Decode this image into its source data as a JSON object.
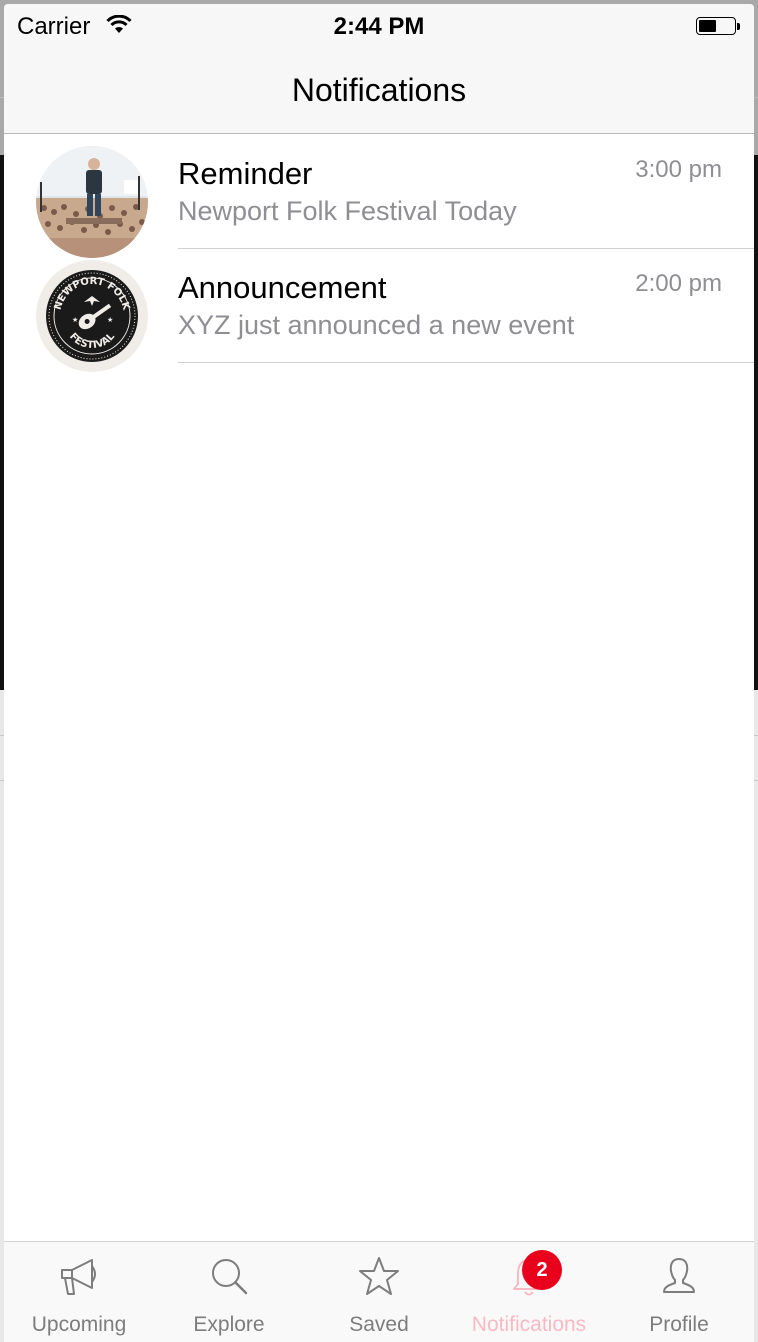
{
  "status_bar": {
    "carrier": "Carrier",
    "time": "2:44 PM",
    "wifi_icon": "wifi-icon",
    "battery_icon": "battery-icon",
    "battery_level": 0.5
  },
  "nav": {
    "title": "Notifications"
  },
  "notifications": [
    {
      "title": "Reminder",
      "subtitle": "Newport Folk Festival Today",
      "time": "3:00 pm",
      "avatar": "concert-photo-avatar"
    },
    {
      "title": "Announcement",
      "subtitle": "XYZ just announced a new event",
      "time": "2:00 pm",
      "avatar": "newport-folk-festival-logo"
    }
  ],
  "logo_text": {
    "top": "NEWPORT FOLK",
    "bottom": "FESTIVAL"
  },
  "tabs": [
    {
      "label": "Upcoming",
      "icon": "megaphone-icon",
      "active": false
    },
    {
      "label": "Explore",
      "icon": "search-icon",
      "active": false
    },
    {
      "label": "Saved",
      "icon": "star-icon",
      "active": false
    },
    {
      "label": "Notifications",
      "icon": "bell-icon",
      "active": true,
      "badge": "2"
    },
    {
      "label": "Profile",
      "icon": "profile-icon",
      "active": false
    }
  ],
  "colors": {
    "active_tab": "#f9b9c4",
    "inactive_tab": "#7d7d7d",
    "badge": "#e8001c"
  }
}
